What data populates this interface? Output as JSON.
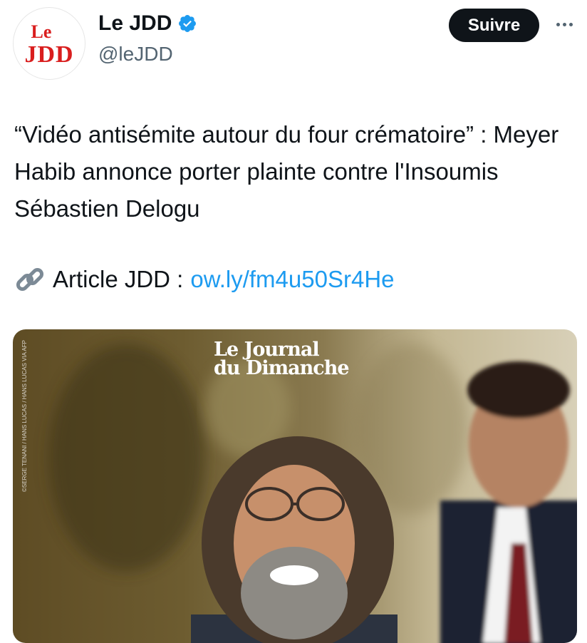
{
  "account": {
    "avatar_line1": "Le",
    "avatar_line2": "JDD",
    "display_name": "Le JDD",
    "handle": "@leJDD",
    "verified_icon": "verified-badge-icon"
  },
  "actions": {
    "follow_label": "Suivre",
    "more_icon": "more-icon"
  },
  "tweet": {
    "text": "“Vidéo antisémite autour du four crématoire” : Meyer Habib annonce porter plainte contre l'Insoumis Sébastien Delogu",
    "link_icon": "link-icon",
    "link_prefix": "Article JDD :",
    "link_url": "ow.ly/fm4u50Sr4He"
  },
  "media": {
    "masthead_line1": "Le Journal",
    "masthead_line2": "du Dimanche",
    "photo_credit": "©SERGE TENANI / HANS LUCAS / HANS LUCAS VIA AFP"
  },
  "colors": {
    "accent_link": "#1d9bf0",
    "follow_bg": "#0f1419",
    "brand_red": "#d91e1e",
    "secondary_text": "#536471"
  }
}
